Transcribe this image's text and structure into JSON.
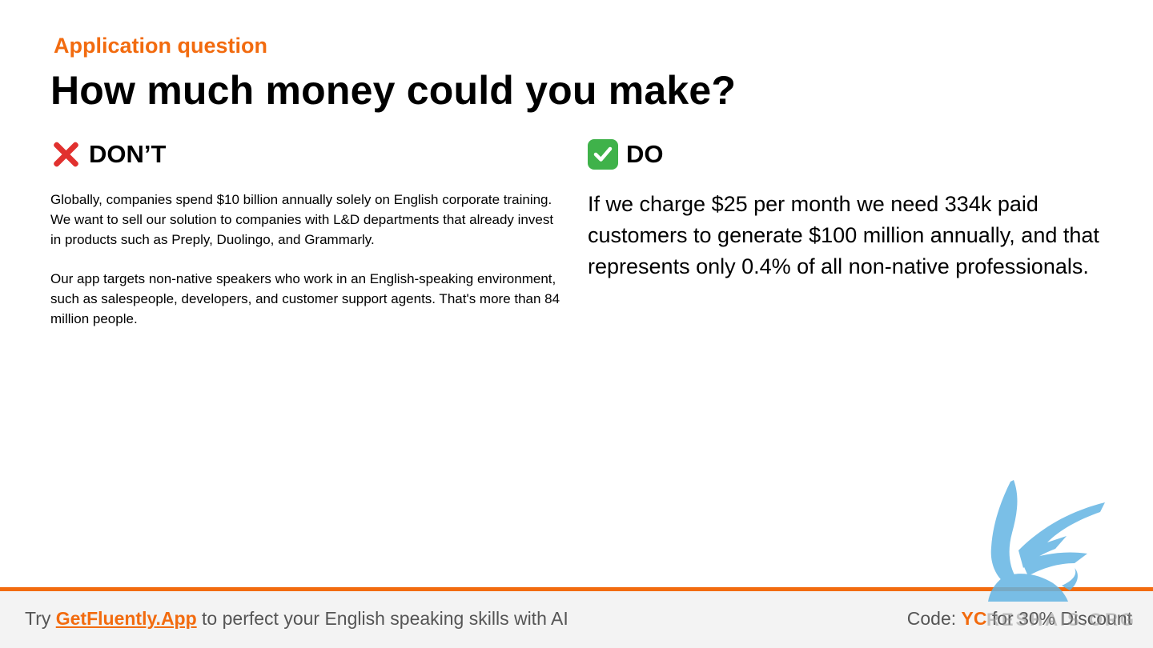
{
  "slide": {
    "eyebrow": "Application question",
    "title": "How much money could you make?"
  },
  "dont": {
    "icon": "cross-mark-icon",
    "heading": "DON’T",
    "paragraphs": [
      "Globally, companies spend $10 billion annually solely on English corporate training. We want to sell our solution to companies with L&D departments that already invest in products such as Preply, Duolingo, and Grammarly.",
      "Our app targets non-native speakers who work in an English-speaking environment, such as salespeople, developers, and customer support agents. That's more than 84 million people."
    ]
  },
  "do": {
    "icon": "check-mark-icon",
    "heading": "DO",
    "text": "If we charge $25 per month we need 334k paid customers to generate $100 million annually, and that represents only 0.4% of all non-native professionals."
  },
  "footer": {
    "prefix": "Try ",
    "link": "GetFluently.App",
    "suffix": " to perfect your English speaking skills with AI",
    "code_prefix": "Code: ",
    "code": "YC",
    "code_suffix": " for 30% Discount"
  },
  "watermark": {
    "text": "RESHAIS.ORG",
    "icon": "griffin-logo-icon"
  },
  "colors": {
    "accent": "#f26b0f",
    "cross": "#e1312f",
    "check": "#3fb24a"
  }
}
